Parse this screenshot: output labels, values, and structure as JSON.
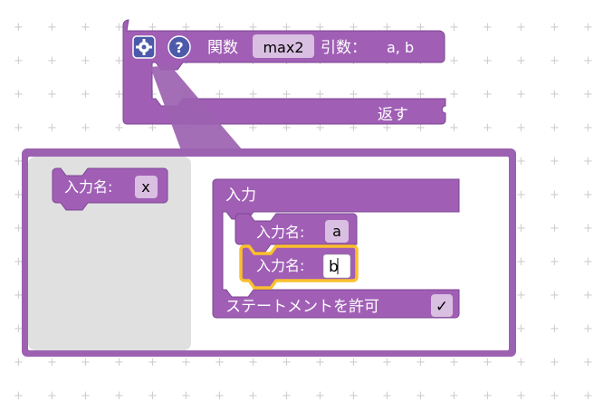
{
  "function_block": {
    "keyword": "関数",
    "name": "max2",
    "params_label": "引数：",
    "params": "a, b",
    "return_label": "返す"
  },
  "mutator": {
    "source_block": {
      "label": "入力名:",
      "value": "x"
    },
    "container_block": {
      "title": "入力",
      "inputs": [
        {
          "label": "入力名:",
          "value": "a"
        },
        {
          "label": "入力名:",
          "value": "b"
        }
      ],
      "statements_label": "ステートメントを許可",
      "statements_checked": "✓"
    }
  },
  "icons": [
    "gear-icon",
    "help-icon"
  ],
  "colors": {
    "block": "#a05fb5",
    "block_dark": "#7d4693",
    "flyout": "#e0e0e0",
    "selection": "#fbc02d"
  }
}
